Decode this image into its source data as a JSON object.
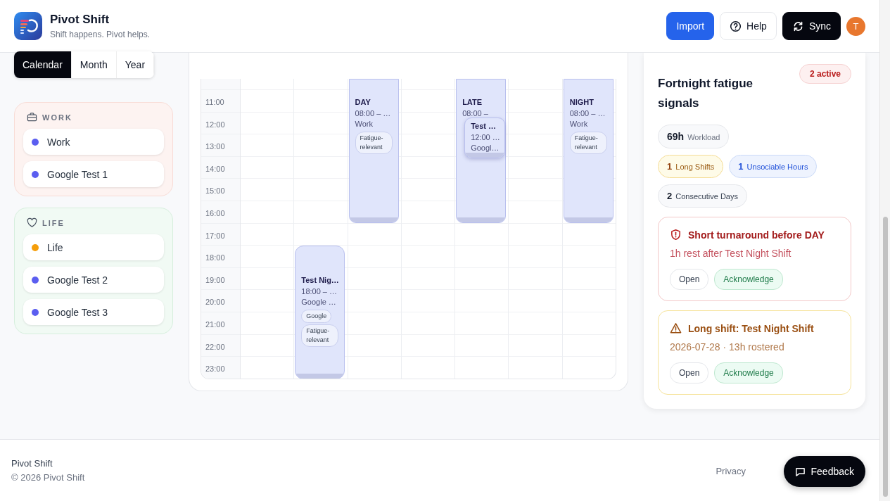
{
  "app": {
    "name": "Pivot Shift",
    "tagline": "Shift happens. Pivot helps."
  },
  "header_actions": [
    {
      "label": "Import",
      "kind": "primary"
    },
    {
      "label": "Help",
      "kind": "help"
    },
    {
      "label": "Sync",
      "kind": "sync"
    }
  ],
  "avatar": "T",
  "view_tabs": [
    {
      "label": "Calendar",
      "selected": true
    },
    {
      "label": "Month",
      "selected": false
    },
    {
      "label": "Year",
      "selected": false
    }
  ],
  "calendar_groups": [
    {
      "title": "WORK",
      "kind": "work",
      "items": [
        {
          "label": "Work",
          "color": "#5b5ef0"
        },
        {
          "label": "Google Test 1",
          "color": "#5b5ef0"
        }
      ]
    },
    {
      "title": "LIFE",
      "kind": "life",
      "items": [
        {
          "label": "Life",
          "color": "#f59e0b"
        },
        {
          "label": "Google Test 2",
          "color": "#5b5ef0"
        },
        {
          "label": "Google Test 3",
          "color": "#5b5ef0"
        }
      ]
    }
  ],
  "calendar": {
    "hours": [
      "11:00",
      "12:00",
      "13:00",
      "14:00",
      "15:00",
      "16:00",
      "17:00",
      "18:00",
      "19:00",
      "20:00",
      "21:00",
      "22:00",
      "23:00"
    ],
    "days": [
      {
        "kind": "free"
      },
      {
        "kind": "rostered",
        "events": [
          {
            "title": "Test Nig…",
            "time": "18:00 – …",
            "calendar": "Google …",
            "tags": [
              "Google",
              "Fatigue-relevant"
            ]
          }
        ]
      },
      {
        "kind": "rostered",
        "events": [
          {
            "title": "DAY",
            "time": "08:00 – …",
            "calendar": "Work",
            "tags": [
              "Fatigue-relevant"
            ]
          }
        ]
      },
      {
        "kind": "free"
      },
      {
        "kind": "rostered",
        "events": [
          {
            "title": "LATE",
            "time": "08:00 –"
          },
          {
            "title": "Test …",
            "time": "12:00 …",
            "calendar": "Googl…"
          }
        ]
      },
      {
        "kind": "free"
      },
      {
        "kind": "rostered",
        "events": [
          {
            "title": "NIGHT",
            "time": "08:00 – …",
            "calendar": "Work",
            "tags": [
              "Fatigue-relevant"
            ]
          }
        ]
      }
    ]
  },
  "fatigue": {
    "title": "Fortnight fatigue signals",
    "badge": "2 active",
    "stats": [
      {
        "value": "69h",
        "label": "Workload",
        "kind": "total"
      },
      {
        "value": "1",
        "label": "Long Shifts",
        "kind": "warning"
      },
      {
        "value": "1",
        "label": "Unsociable Hours",
        "kind": "info"
      },
      {
        "value": "2",
        "label": "Consecutive Days",
        "kind": "neutral"
      }
    ],
    "alerts": [
      {
        "kind": "danger",
        "title": "Short turnaround before DAY",
        "detail": "1h rest after Test Night Shift",
        "actions": [
          "Open",
          "Acknowledge"
        ]
      },
      {
        "kind": "warning",
        "title": "Long shift: Test Night Shift",
        "detail": "2026-07-28 · 13h rostered",
        "actions": [
          "Open",
          "Acknowledge"
        ]
      }
    ]
  },
  "footer": {
    "brand": "Pivot Shift",
    "copyright": "© 2026 Pivot Shift",
    "links": [
      "Privacy"
    ],
    "feedback": "Feedback"
  }
}
